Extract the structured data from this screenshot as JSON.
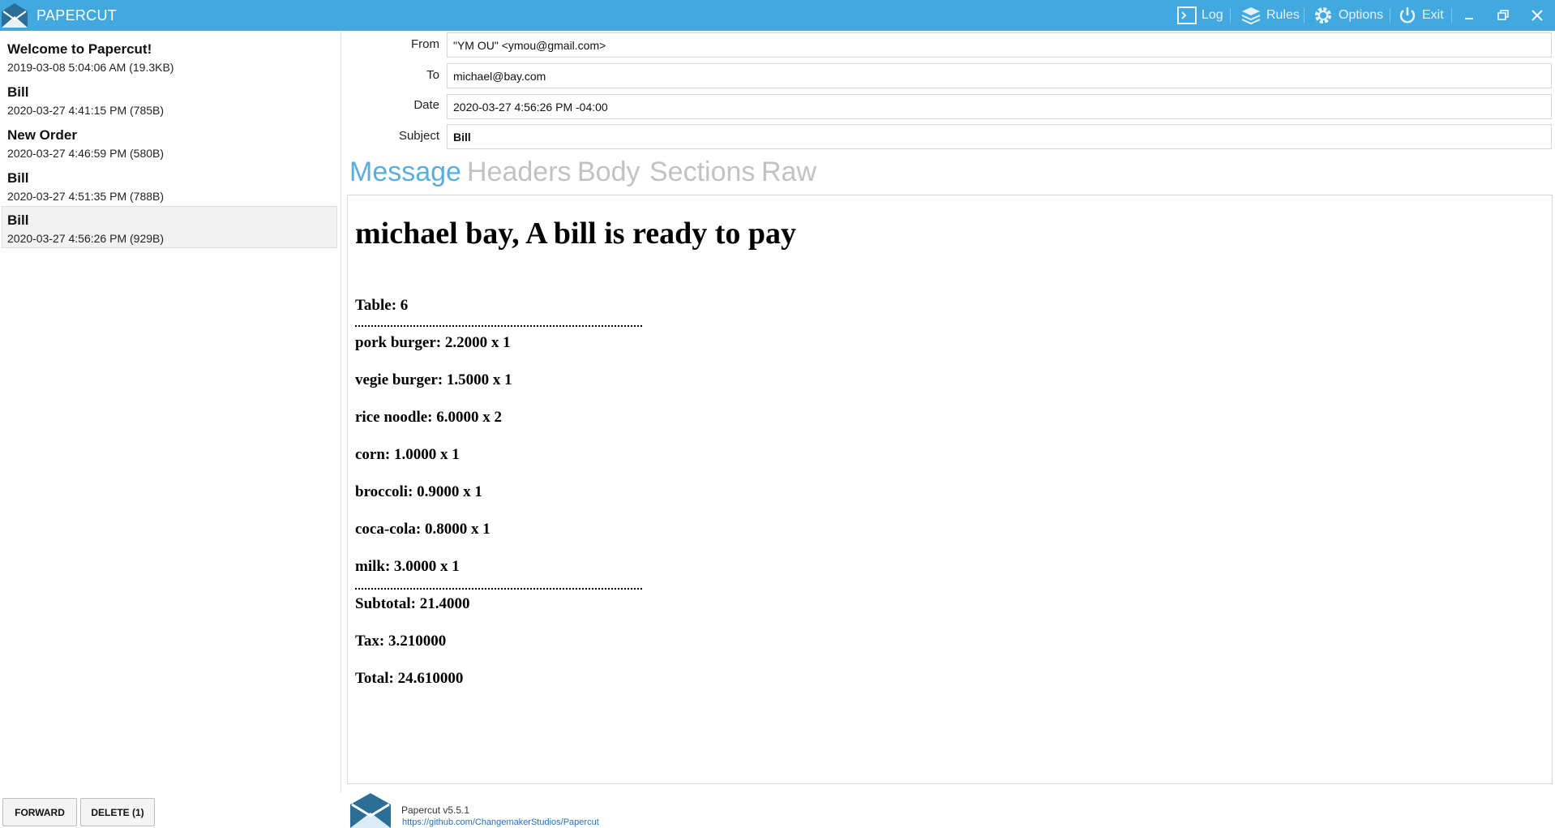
{
  "app": {
    "title": "PAPERCUT"
  },
  "titlebar": {
    "buttons": [
      {
        "label": "Log",
        "icon": "terminal-icon"
      },
      {
        "label": "Rules",
        "icon": "layers-icon"
      },
      {
        "label": "Options",
        "icon": "gear-icon"
      },
      {
        "label": "Exit",
        "icon": "power-icon"
      }
    ]
  },
  "messages": [
    {
      "subject": "Welcome to Papercut!",
      "meta": "2019-03-08 5:04:06 AM (19.3KB)"
    },
    {
      "subject": "Bill",
      "meta": "2020-03-27 4:41:15 PM (785B)"
    },
    {
      "subject": "New Order",
      "meta": "2020-03-27 4:46:59 PM (580B)"
    },
    {
      "subject": "Bill",
      "meta": "2020-03-27 4:51:35 PM (788B)"
    },
    {
      "subject": "Bill",
      "meta": "2020-03-27 4:56:26 PM (929B)"
    }
  ],
  "list_actions": {
    "forward": "FORWARD",
    "delete": "DELETE (1)"
  },
  "header": {
    "from_label": "From",
    "from": "\"YM OU\" <ymou@gmail.com>",
    "to_label": "To",
    "to": "michael@bay.com",
    "date_label": "Date",
    "date": "2020-03-27 4:56:26 PM -04:00",
    "subject_label": "Subject",
    "subject": "Bill"
  },
  "tabs": [
    "Message",
    "Headers",
    "Body",
    "Sections",
    "Raw"
  ],
  "body": {
    "heading": "michael bay, A bill is ready to pay",
    "table": "Table: 6",
    "items": [
      "pork burger: 2.2000 x 1",
      "vegie burger: 1.5000 x 1",
      "rice noodle: 6.0000 x 2",
      "corn: 1.0000 x 1",
      "broccoli: 0.9000 x 1",
      "coca-cola: 0.8000 x 1",
      "milk: 3.0000 x 1"
    ],
    "subtotal": "Subtotal: 21.4000",
    "tax": "Tax: 3.210000",
    "total": "Total: 24.610000"
  },
  "footer": {
    "version": "Papercut v5.5.1",
    "link": "https://github.com/ChangemakerStudios/Papercut"
  },
  "colors": {
    "accent": "#41a9e0",
    "active_tab": "#5aaedc",
    "inactive_tab": "#c2c2c2"
  }
}
